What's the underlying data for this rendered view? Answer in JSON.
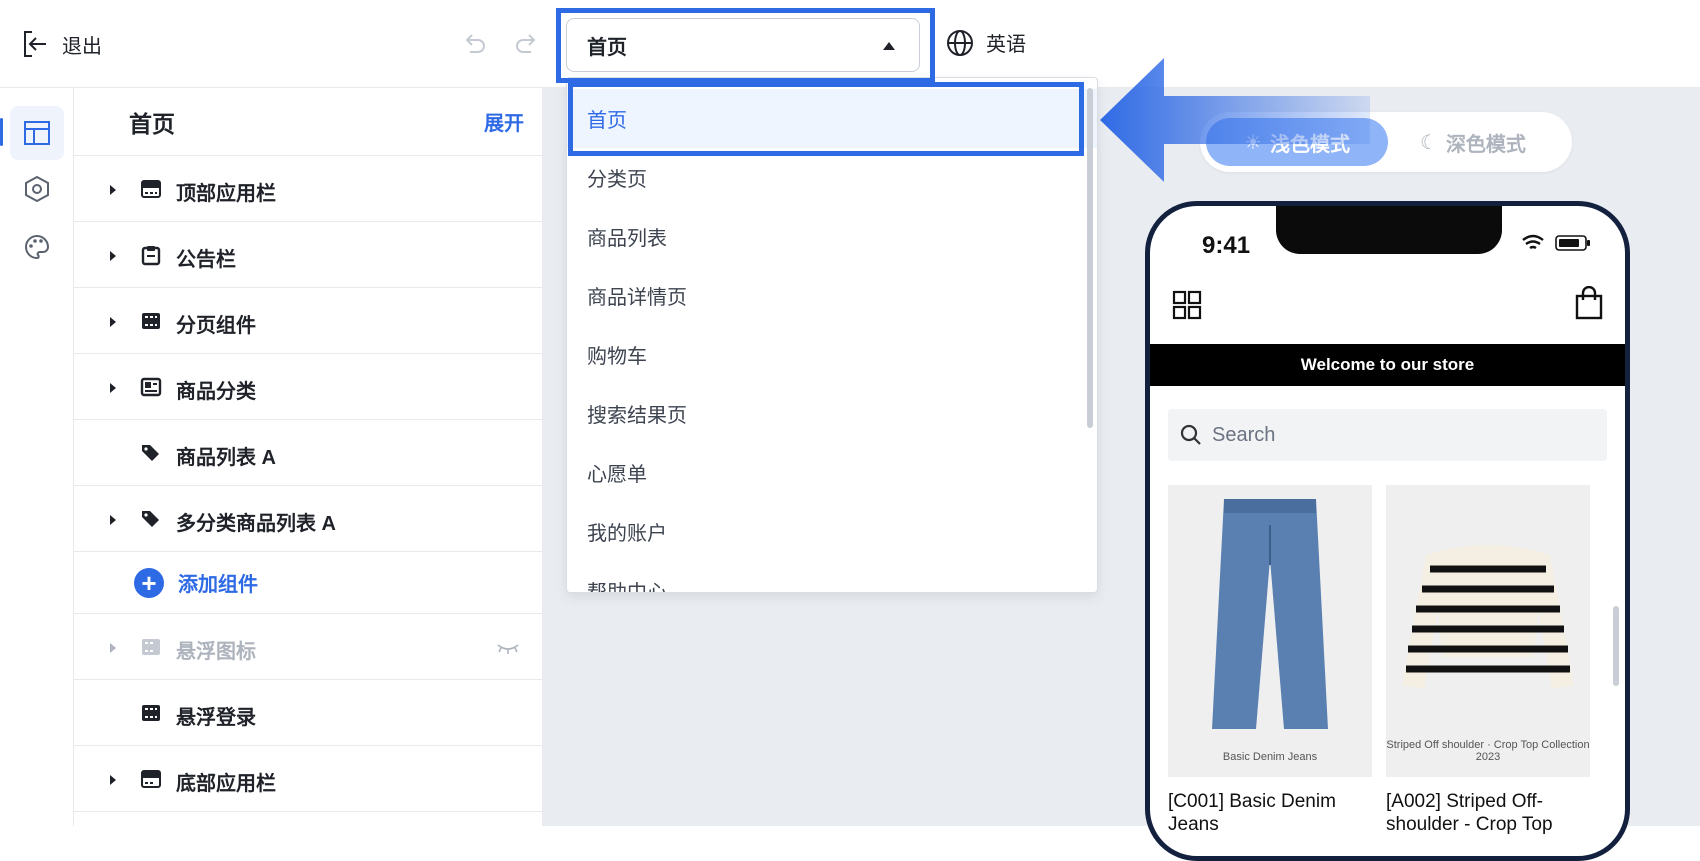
{
  "topbar": {
    "exit_label": "退出",
    "page_select_value": "首页",
    "language_label": "英语"
  },
  "sidebar_panel": {
    "title": "首页",
    "expand_label": "展开",
    "items": [
      {
        "label": "顶部应用栏",
        "icon": "app-bar-icon",
        "expandable": true,
        "hidden": false
      },
      {
        "label": "公告栏",
        "icon": "clipboard-icon",
        "expandable": true,
        "hidden": false
      },
      {
        "label": "分页组件",
        "icon": "film-grid-icon",
        "expandable": true,
        "hidden": false
      },
      {
        "label": "商品分类",
        "icon": "id-card-icon",
        "expandable": true,
        "hidden": false
      },
      {
        "label": "商品列表 A",
        "icon": "tags-icon",
        "expandable": false,
        "hidden": false
      },
      {
        "label": "多分类商品列表 A",
        "icon": "tags-icon",
        "expandable": true,
        "hidden": false
      }
    ],
    "add_component_label": "添加组件",
    "items_after": [
      {
        "label": "悬浮图标",
        "icon": "film-grid-icon",
        "expandable": true,
        "hidden": true
      },
      {
        "label": "悬浮登录",
        "icon": "film-grid-icon",
        "expandable": false,
        "hidden": false
      },
      {
        "label": "底部应用栏",
        "icon": "app-bar-icon",
        "expandable": true,
        "hidden": false
      }
    ]
  },
  "dropdown": {
    "options": [
      "首页",
      "分类页",
      "商品列表",
      "商品详情页",
      "购物车",
      "搜索结果页",
      "心愿单",
      "我的账户",
      "帮助中心"
    ],
    "selected": "首页"
  },
  "preview": {
    "mode_light_label": "浅色模式",
    "mode_dark_label": "深色模式",
    "time": "9:41",
    "banner": "Welcome to our store",
    "search_placeholder": "Search",
    "products": [
      {
        "name": "[C001] Basic Denim Jeans",
        "image_caption": "Basic Denim Jeans"
      },
      {
        "name": "[A002] Striped Off-shoulder - Crop Top",
        "image_caption": "Striped Off shoulder · Crop Top Collection 2023"
      }
    ]
  },
  "colors": {
    "accent": "#2f6ae5",
    "canvas_bg": "#e9ecf1",
    "selected_bg": "#eef5ff",
    "phone_frame": "#13213f"
  }
}
